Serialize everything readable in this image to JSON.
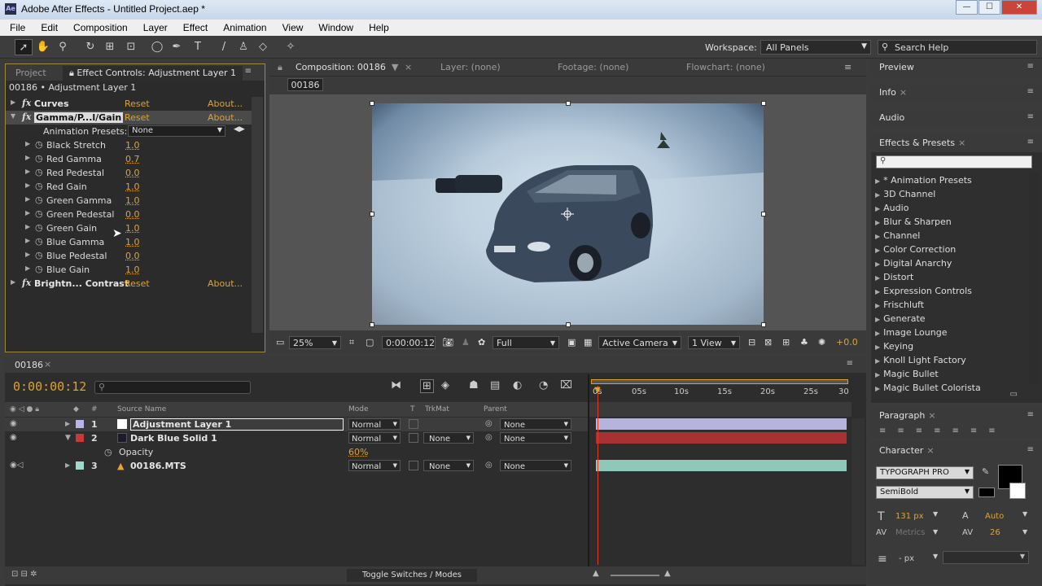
{
  "window": {
    "title": "Adobe After Effects - Untitled Project.aep *",
    "app_icon": "Ae"
  },
  "menu": [
    "File",
    "Edit",
    "Composition",
    "Layer",
    "Effect",
    "Animation",
    "View",
    "Window",
    "Help"
  ],
  "toolbar": {
    "workspace_label": "Workspace:",
    "workspace_value": "All Panels",
    "search_placeholder": "Search Help"
  },
  "effect_controls": {
    "tabs": [
      "Project",
      "Effect Controls: Adjustment Layer 1"
    ],
    "layer_header": "00186 • Adjustment Layer 1",
    "effects": [
      {
        "name": "Curves",
        "reset": "Reset",
        "about": "About..."
      },
      {
        "name": "Gamma/P...l/Gain",
        "reset": "Reset",
        "about": "About..."
      },
      {
        "name": "Brightn... Contrast",
        "reset": "Reset",
        "about": "About..."
      }
    ],
    "presets_label": "Animation Presets:",
    "presets_value": "None",
    "params": [
      {
        "name": "Black Stretch",
        "value": "1.0"
      },
      {
        "name": "Red Gamma",
        "value": "0.7"
      },
      {
        "name": "Red Pedestal",
        "value": "0.0"
      },
      {
        "name": "Red Gain",
        "value": "1.0"
      },
      {
        "name": "Green Gamma",
        "value": "1.0"
      },
      {
        "name": "Green Pedestal",
        "value": "0.0"
      },
      {
        "name": "Green Gain",
        "value": "1.0"
      },
      {
        "name": "Blue Gamma",
        "value": "1.0"
      },
      {
        "name": "Blue Pedestal",
        "value": "0.0"
      },
      {
        "name": "Blue Gain",
        "value": "1.0"
      }
    ]
  },
  "composition": {
    "tab": "Composition: 00186",
    "layer_tab": "Layer: (none)",
    "footage_tab": "Footage: (none)",
    "flowchart_tab": "Flowchart: (none)",
    "sub_tab": "00186",
    "zoom": "25%",
    "timecode": "0:00:00:12",
    "resolution": "Full",
    "camera": "Active Camera",
    "views": "1 View",
    "exposure": "+0.0"
  },
  "right_panels": {
    "preview": "Preview",
    "info": "Info",
    "audio": "Audio",
    "effects_presets": "Effects & Presets",
    "effects_list": [
      "* Animation Presets",
      "3D Channel",
      "Audio",
      "Blur & Sharpen",
      "Channel",
      "Color Correction",
      "Digital Anarchy",
      "Distort",
      "Expression Controls",
      "Frischluft",
      "Generate",
      "Image Lounge",
      "Keying",
      "Knoll Light Factory",
      "Magic Bullet",
      "Magic Bullet Colorista"
    ],
    "paragraph": "Paragraph",
    "character": "Character",
    "font": "TYPOGRAPH PRO",
    "font_style": "SemiBold",
    "font_size": "131 px",
    "leading": "Auto",
    "kerning": "Metrics",
    "tracking": "26",
    "stroke": "- px"
  },
  "timeline": {
    "tab": "00186",
    "timecode": "0:00:00:12",
    "columns": {
      "num": "#",
      "source": "Source Name",
      "mode": "Mode",
      "t": "T",
      "trkmat": "TrkMat",
      "parent": "Parent"
    },
    "ruler": [
      "0s",
      "05s",
      "10s",
      "15s",
      "20s",
      "25s",
      "30"
    ],
    "layers": [
      {
        "num": "1",
        "name": "Adjustment Layer 1",
        "mode": "Normal",
        "trkmat": "",
        "parent": "None",
        "label_color": "#b9b5e8",
        "bar_color": "#b6b3df"
      },
      {
        "num": "2",
        "name": "Dark Blue Solid 1",
        "mode": "Normal",
        "trkmat": "None",
        "parent": "None",
        "label_color": "#c83a3a",
        "bar_color": "#a83232"
      },
      {
        "num": "3",
        "name": "00186.MTS",
        "mode": "Normal",
        "trkmat": "None",
        "parent": "None",
        "label_color": "#9fd9cc",
        "bar_color": "#8fc7b8"
      }
    ],
    "opacity_label": "Opacity",
    "opacity_value": "60%",
    "toggle_label": "Toggle Switches / Modes"
  }
}
